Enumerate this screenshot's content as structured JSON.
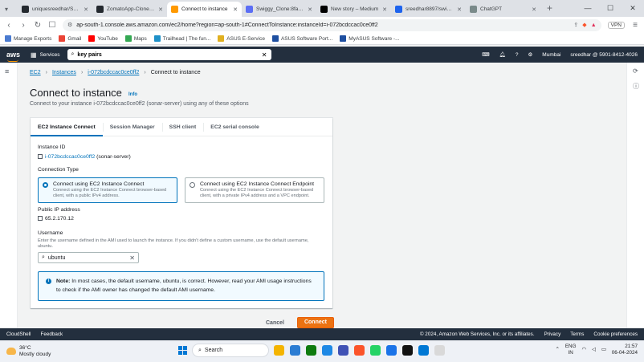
{
  "browser": {
    "tabs": [
      {
        "title": "uniquesreedhar/Swiggy_C",
        "color": "#24292f",
        "active": false
      },
      {
        "title": "ZomatoApp-Clone/Github",
        "color": "#24292f",
        "active": false
      },
      {
        "title": "Connect to instance",
        "color": "#ff9900",
        "active": true
      },
      {
        "title": "Swiggy_Clone:8fae6ef6-7",
        "color": "#5b6ef5",
        "active": false
      },
      {
        "title": "New story – Medium",
        "color": "#000000",
        "active": false
      },
      {
        "title": "sreedhar8897/swiggy Tag",
        "color": "#1d63ed",
        "active": false
      },
      {
        "title": "ChatGPT",
        "color": "#7a8a8a",
        "active": false
      }
    ],
    "new_tab": "+",
    "url": "ap-south-1.console.aws.amazon.com/ec2/home?region=ap-south-1#ConnectToInstance:instanceId=i-072bcdccac0ce0ff2",
    "vpn": "VPN",
    "bookmarks": [
      {
        "label": "Manage Exports",
        "color": "#4a7bd0"
      },
      {
        "label": "Gmail",
        "color": "#ea4335"
      },
      {
        "label": "YouTube",
        "color": "#ff0000"
      },
      {
        "label": "Maps",
        "color": "#34a853"
      },
      {
        "label": "Trailhead | The fun...",
        "color": "#1e90c8"
      },
      {
        "label": "ASUS E-Service",
        "color": "#e0b020"
      },
      {
        "label": "ASUS Software Port...",
        "color": "#1e4fa0"
      },
      {
        "label": "MyASUS Software -...",
        "color": "#1e4fa0"
      }
    ]
  },
  "aws": {
    "logo": "aws",
    "services": "Services",
    "search_value": "key pairs",
    "region": "Mumbai",
    "account": "sreedhar @ 5901-8412-4026"
  },
  "breadcrumb": {
    "items": [
      "EC2",
      "Instances",
      "i-072bcdccac0ce0ff2"
    ],
    "current": "Connect to instance"
  },
  "page": {
    "title": "Connect to instance",
    "info": "Info",
    "subtitle": "Connect to your instance i-072bcdccac0ce0ff2 (sonar-server) using any of these options"
  },
  "tabs": [
    "EC2 Instance Connect",
    "Session Manager",
    "SSH client",
    "EC2 serial console"
  ],
  "form": {
    "instance_id_label": "Instance ID",
    "instance_id": "i-072bcdccac0ce0ff2",
    "instance_name": "(sonar-server)",
    "connection_type_label": "Connection Type",
    "options": [
      {
        "title": "Connect using EC2 Instance Connect",
        "desc": "Connect using the EC2 Instance Connect browser-based client, with a public IPv4 address.",
        "selected": true
      },
      {
        "title": "Connect using EC2 Instance Connect Endpoint",
        "desc": "Connect using the EC2 Instance Connect browser-based client, with a private IPv4 address and a VPC endpoint.",
        "selected": false
      }
    ],
    "public_ip_label": "Public IP address",
    "public_ip": "65.2.170.12",
    "username_label": "Username",
    "username_hint": "Enter the username defined in the AMI used to launch the instance. If you didn't define a custom username, use the default username, ubuntu.",
    "username_value": "ubuntu",
    "note_strong": "Note:",
    "note_text": "In most cases, the default username, ubuntu, is correct. However, read your AMI usage instructions to check if the AMI owner has changed the default AMI username."
  },
  "actions": {
    "cancel": "Cancel",
    "connect": "Connect"
  },
  "footer": {
    "cloudshell": "CloudShell",
    "feedback": "Feedback",
    "copyright": "© 2024, Amazon Web Services, Inc. or its affiliates.",
    "privacy": "Privacy",
    "terms": "Terms",
    "cookies": "Cookie preferences"
  },
  "taskbar": {
    "temp": "36°C",
    "weather": "Mostly cloudy",
    "search": "Search",
    "lang1": "ENG",
    "lang2": "IN",
    "time": "21:57",
    "date": "06-04-2024",
    "apps": [
      "#f4b400",
      "#2b7cd3",
      "#0f7b0f",
      "#1e88e5",
      "#3f51b5",
      "#fb542b",
      "#25d366",
      "#1a73e8",
      "#111111",
      "#0078d4",
      "#d9d9d9"
    ]
  }
}
